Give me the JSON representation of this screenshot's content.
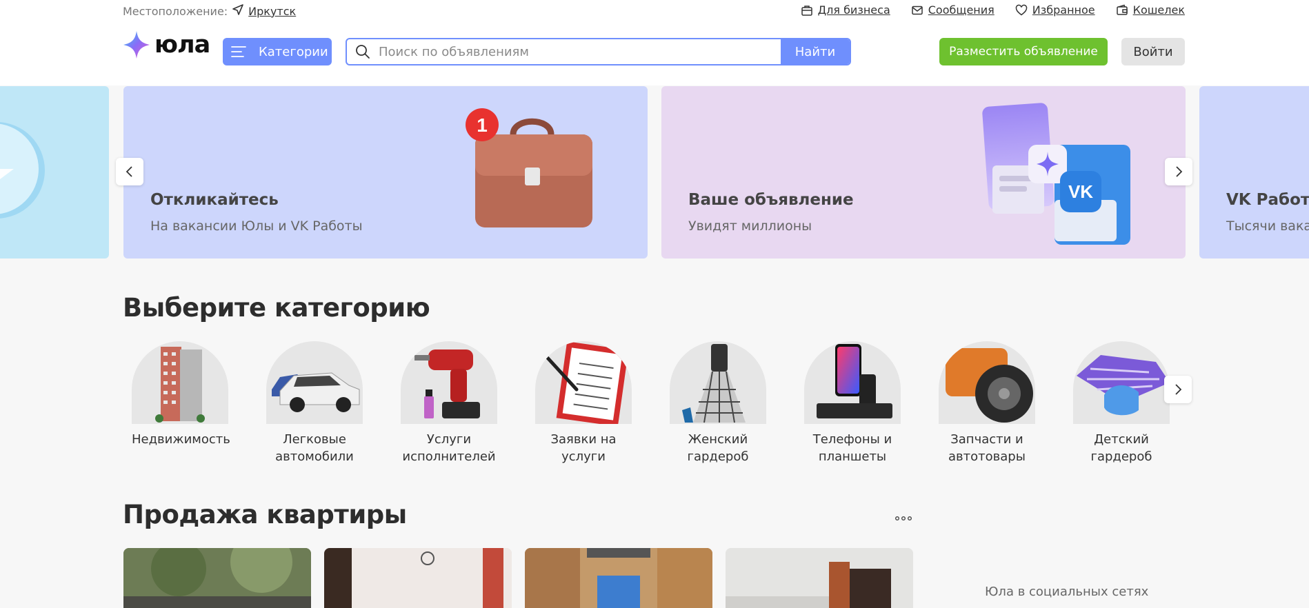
{
  "header": {
    "location_label": "Местоположение:",
    "city": "Иркутск",
    "links": [
      {
        "label": "Для бизнеса",
        "icon": "business-icon"
      },
      {
        "label": "Сообщения",
        "icon": "mail-icon"
      },
      {
        "label": "Избранное",
        "icon": "heart-icon"
      },
      {
        "label": "Кошелек",
        "icon": "wallet-icon"
      }
    ],
    "logo_text": "юла",
    "categories_label": "Категории",
    "search_placeholder": "Поиск по объявлениям",
    "search_button": "Найти",
    "post_button": "Разместить объявление",
    "login_button": "Войти"
  },
  "banners": [
    {
      "title": "Откликайтесь",
      "subtitle": "На вакансии Юлы и VK Работы",
      "badge": "1"
    },
    {
      "title": "Ваше объявление",
      "subtitle": "Увидят миллионы",
      "badge_text": "VK"
    },
    {
      "title": "VK Работа",
      "subtitle": "Тысячи вака"
    }
  ],
  "categories_section": {
    "title": "Выберите категорию",
    "items": [
      {
        "label": "Недвижимость"
      },
      {
        "label": "Легковые автомобили"
      },
      {
        "label": "Услуги исполнителей"
      },
      {
        "label": "Заявки на услуги"
      },
      {
        "label": "Женский гардероб"
      },
      {
        "label": "Телефоны и планшеты"
      },
      {
        "label": "Запчасти и автотовары"
      },
      {
        "label": "Детский гардероб"
      }
    ]
  },
  "listings_section": {
    "title": "Продажа квартиры"
  },
  "sidebar": {
    "social_label": "Юла в социальных сетях"
  },
  "colors": {
    "accent_blue": "#6f8ffd",
    "post_green": "#6ec12f",
    "banner_blue": "#cdd6fc",
    "banner_lilac": "#e8d8f1"
  }
}
